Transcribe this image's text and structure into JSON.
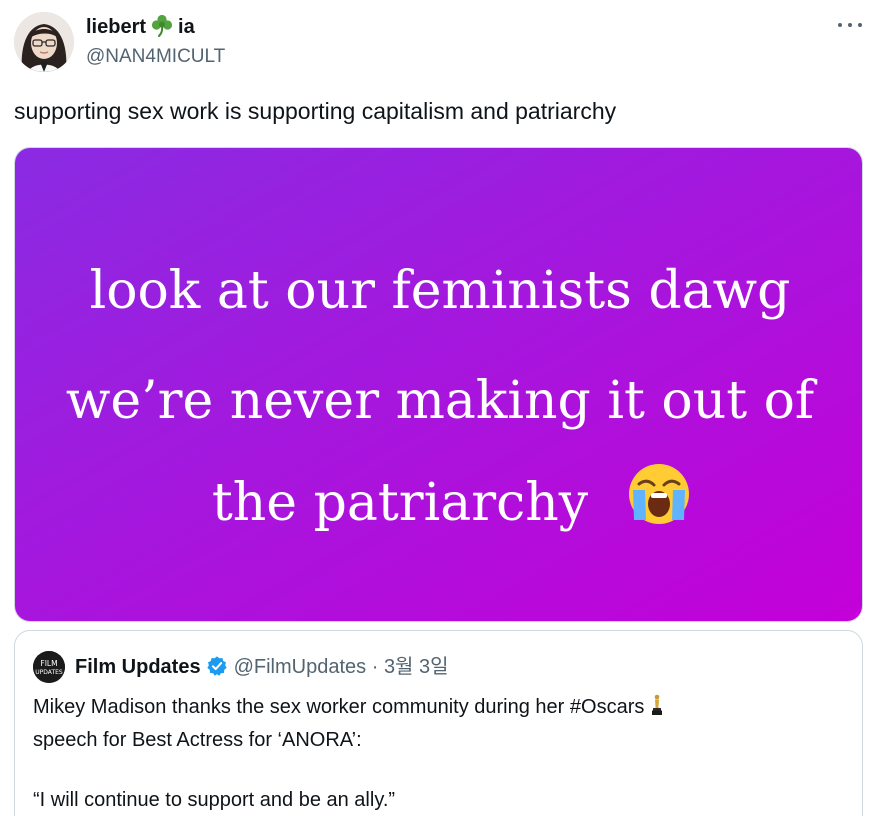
{
  "author": {
    "display_name_start": "liebert",
    "display_name_end": "ia",
    "name_emoji": "shamrock-icon",
    "handle": "@NAN4MICULT"
  },
  "tweet": {
    "text": "supporting sex work is supporting capitalism and patriarchy"
  },
  "media": {
    "lines": [
      "look at our feminists dawg",
      "we’re never making it out of",
      "the patriarchy"
    ],
    "emoji": "loudly-crying-face-icon",
    "gradient_colors": [
      "#8a2be2",
      "#c400d8"
    ]
  },
  "quoted_tweet": {
    "display_name": "Film Updates",
    "verified": true,
    "handle": "@FilmUpdates",
    "separator": "·",
    "date": "3월 3일",
    "avatar_text_top": "FILM",
    "avatar_text_bottom": "UPDATES",
    "line1": "Mikey Madison thanks the sex worker community during her #Oscars",
    "line1_emoji": "oscar-trophy-icon",
    "line2": "speech for Best Actress for ‘ANORA’:",
    "line3": "“I will continue to support and be an ally.”"
  },
  "colors": {
    "text_primary": "#0f1419",
    "text_secondary": "#536471",
    "verified_blue": "#1d9bf0",
    "border": "#cfd9de"
  }
}
